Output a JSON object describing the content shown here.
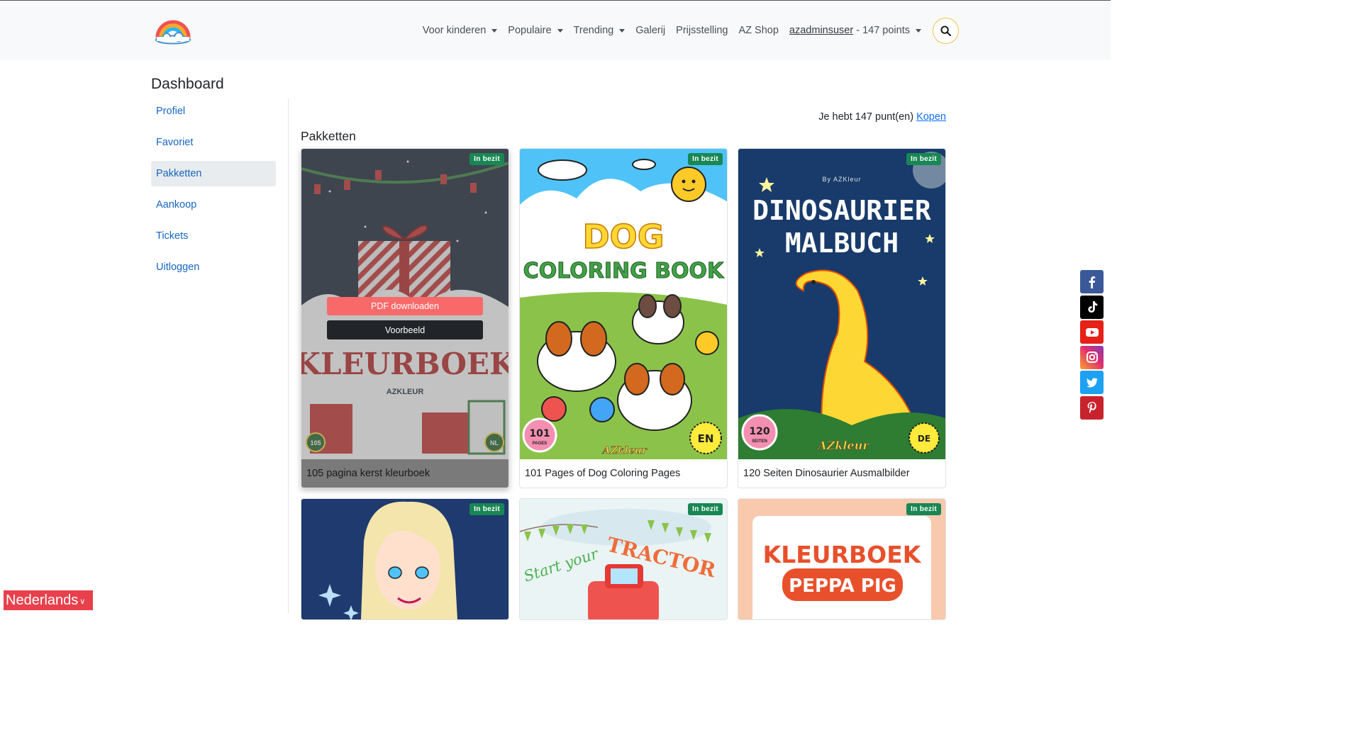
{
  "nav": {
    "items": [
      {
        "label": "Voor kinderen",
        "dropdown": true
      },
      {
        "label": "Populaire",
        "dropdown": true
      },
      {
        "label": "Trending",
        "dropdown": true
      },
      {
        "label": "Galerij",
        "dropdown": false
      },
      {
        "label": "Prijsstelling",
        "dropdown": false
      },
      {
        "label": "AZ Shop",
        "dropdown": false
      }
    ],
    "user": {
      "name": "azadminsuser",
      "points": " - 147 points"
    }
  },
  "dashboard": {
    "title": "Dashboard",
    "sidebar": [
      "Profiel",
      "Favoriet",
      "Pakketten",
      "Aankoop",
      "Tickets",
      "Uitloggen"
    ],
    "active_item": "Pakketten"
  },
  "points": {
    "text": "Je hebt 147 punt(en) ",
    "buy_link": "Kopen"
  },
  "section_title": "Pakketten",
  "cards": [
    {
      "badge": "In bezit",
      "title": "105 pagina kerst kleurboek",
      "cover_text": "KLEURBOEK",
      "cover_sub": "AZKLEUR",
      "pages_badge": "105",
      "lang_badge": "NL"
    },
    {
      "badge": "In bezit",
      "title": "101 Pages of Dog Coloring Pages",
      "cover_title1": "DOG",
      "cover_title2": "COLORING BOOK",
      "pages_badge": "101",
      "pages_sub": "PAGES",
      "lang_badge": "EN",
      "brand": "AZkleur"
    },
    {
      "badge": "In bezit",
      "title": "120 Seiten Dinosaurier Ausmalbilder",
      "cover_by": "By AZKleur",
      "cover_title1": "DINOSAURIER",
      "cover_title2": "MALBUCH",
      "pages_badge": "120",
      "pages_sub": "SEITEN",
      "lang_badge": "DE",
      "brand": "AZkleur"
    },
    {
      "badge": "In bezit"
    },
    {
      "badge": "In bezit",
      "cover_title1": "Start your",
      "cover_title2": "TRACTOR"
    },
    {
      "badge": "In bezit",
      "cover_title1": "KLEURBOEK",
      "cover_title2": "PEPPA PIG"
    }
  ],
  "card_actions": {
    "pdf": "PDF downloaden",
    "preview": "Voorbeeld"
  },
  "social": [
    "facebook-icon",
    "tiktok-icon",
    "youtube-icon",
    "instagram-icon",
    "twitter-icon",
    "pinterest-icon"
  ],
  "language": {
    "label": "Nederlands"
  },
  "colors": {
    "accent": "#0d6efd",
    "badge": "#198754",
    "pdf_button": "#f86a6a",
    "language_bar": "#e8404c"
  }
}
